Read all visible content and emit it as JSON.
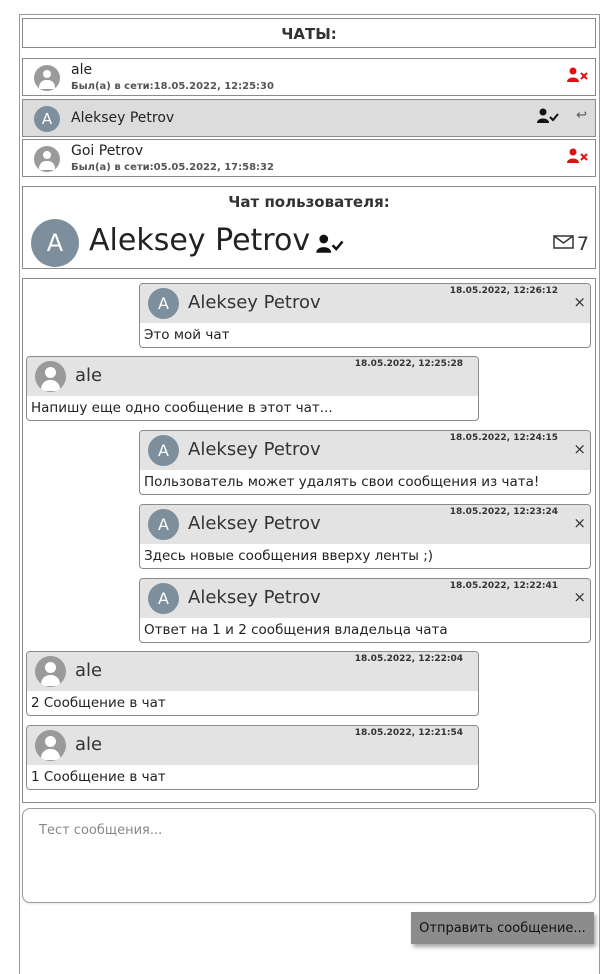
{
  "chats_header": {
    "title": "ЧАТЫ:"
  },
  "chats": [
    {
      "name": "ale",
      "status": "Был(а) в сети:18.05.2022, 12:25:30",
      "avatar": "user-icon",
      "action_icon": "user-remove-icon"
    },
    {
      "name": "Aleksey Petrov",
      "avatar_letter": "A",
      "active": true,
      "action_icon": "user-check-icon",
      "extra_icon": "reply-icon",
      "extra_glyph": "↩"
    },
    {
      "name": "Goi Petrov",
      "status": "Был(а) в сети:05.05.2022, 17:58:32",
      "avatar": "user-icon",
      "action_icon": "user-remove-icon"
    }
  ],
  "user_chat": {
    "title": "Чат пользователя:",
    "avatar_letter": "A",
    "name": "Aleksey Petrov",
    "messages_count": "7"
  },
  "messages": [
    {
      "author": "Aleksey Petrov",
      "avatar_letter": "A",
      "own": true,
      "time": "18.05.2022, 12:26:12",
      "text": "Это мой чат",
      "close": "×"
    },
    {
      "author": "ale",
      "own": false,
      "time": "18.05.2022, 12:25:28",
      "text": "Напишу еще одно сообщение в этот чат..."
    },
    {
      "author": "Aleksey Petrov",
      "avatar_letter": "A",
      "own": true,
      "time": "18.05.2022, 12:24:15",
      "text": "Пользователь может удалять свои сообщения из чата!",
      "close": "×"
    },
    {
      "author": "Aleksey Petrov",
      "avatar_letter": "A",
      "own": true,
      "time": "18.05.2022, 12:23:24",
      "text": "Здесь новые сообщения вверху ленты ;)",
      "close": "×"
    },
    {
      "author": "Aleksey Petrov",
      "avatar_letter": "A",
      "own": true,
      "time": "18.05.2022, 12:22:41",
      "text": "Ответ на 1 и 2 сообщения владельца чата",
      "close": "×"
    },
    {
      "author": "ale",
      "own": false,
      "time": "18.05.2022, 12:22:04",
      "text": "2 Сообщение в чат"
    },
    {
      "author": "ale",
      "own": false,
      "time": "18.05.2022, 12:21:54",
      "text": "1 Сообщение в чат"
    }
  ],
  "composer": {
    "placeholder": "Тест сообщения...",
    "send_label": "Отправить сообщение..."
  },
  "colors": {
    "remove": "#e01010",
    "avatar_letter_bg": "#7d8f9c",
    "avatar_user_bg": "#9a9a9a",
    "active_bg": "#dcdcdc"
  }
}
